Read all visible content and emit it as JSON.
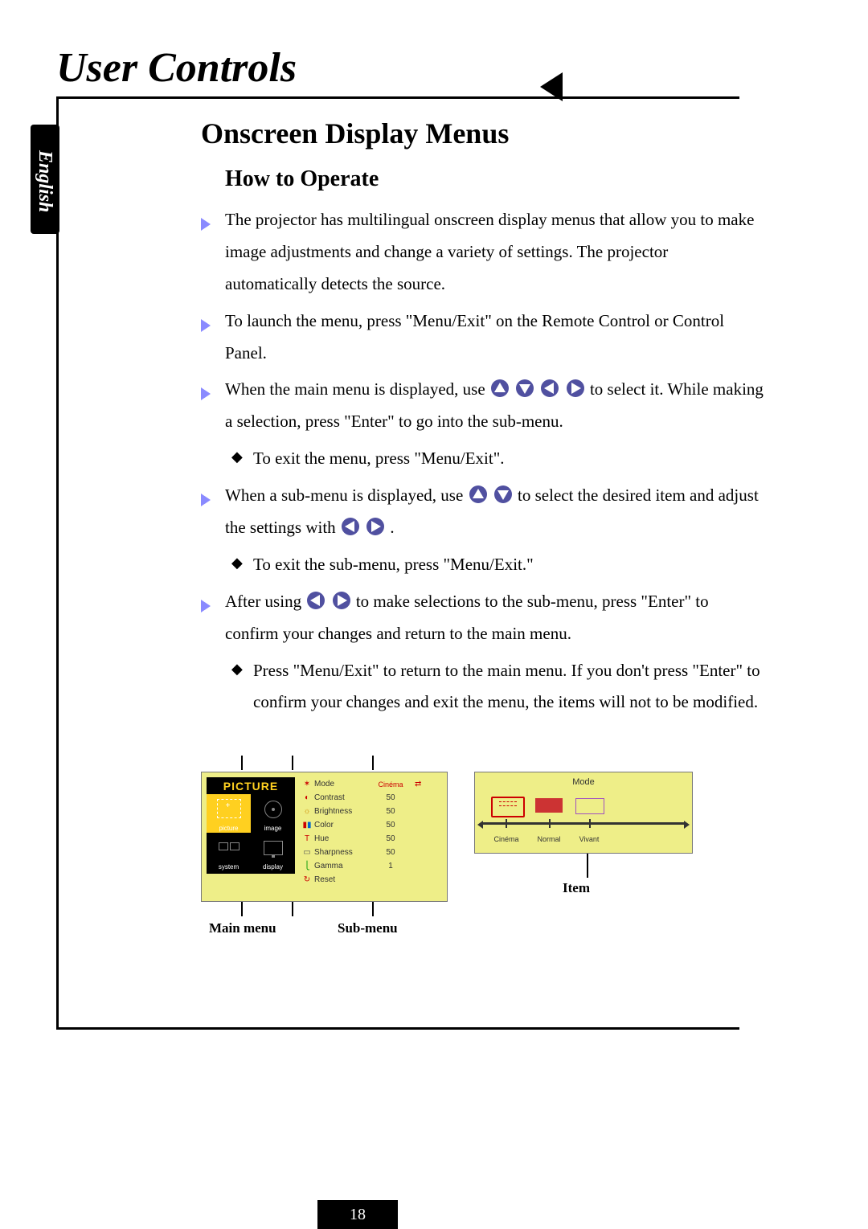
{
  "lang_tab": "English",
  "title": "User Controls",
  "section": "Onscreen Display Menus",
  "subsection": "How to Operate",
  "bullets": {
    "b1": "The projector has multilingual onscreen display menus that allow you to make image adjustments and change a variety of settings. The projector automatically detects the source.",
    "b2": "To launch the menu, press \"Menu/Exit\" on the Remote Control or Control Panel.",
    "b3a": "When the main menu is displayed, use ",
    "b3b": " to select it. While making a selection, press \"Enter\" to go into the sub-menu.",
    "b3s": "To exit the menu, press \"Menu/Exit\".",
    "b4a": "When a sub-menu is displayed, use ",
    "b4b": " to select the desired item and adjust the settings with ",
    "b4c": " .",
    "b4s": "To exit the sub-menu, press \"Menu/Exit.\"",
    "b5a": "After using ",
    "b5b": " to make selections to the sub-menu, press \"Enter\" to confirm your changes and return to the main menu.",
    "b5s": "Press \"Menu/Exit\" to return to the main menu.  If you don't press \"Enter\" to confirm your changes and exit the menu, the items will not to be modified."
  },
  "osd": {
    "main_header": "PICTURE",
    "tabs": {
      "picture": "picture",
      "image": "image",
      "system": "system",
      "display": "display"
    },
    "rows": [
      {
        "label": "Mode",
        "value": "Cinéma"
      },
      {
        "label": "Contrast",
        "value": "50"
      },
      {
        "label": "Brightness",
        "value": "50"
      },
      {
        "label": "Color",
        "value": "50"
      },
      {
        "label": "Hue",
        "value": "50"
      },
      {
        "label": "Sharpness",
        "value": "50"
      },
      {
        "label": "Gamma",
        "value": "1"
      },
      {
        "label": "Reset",
        "value": ""
      }
    ],
    "item_title": "Mode",
    "options": [
      "Cinéma",
      "Normal",
      "Vivant"
    ]
  },
  "captions": {
    "main": "Main menu",
    "sub": "Sub-menu",
    "item": "Item"
  },
  "page": "18"
}
